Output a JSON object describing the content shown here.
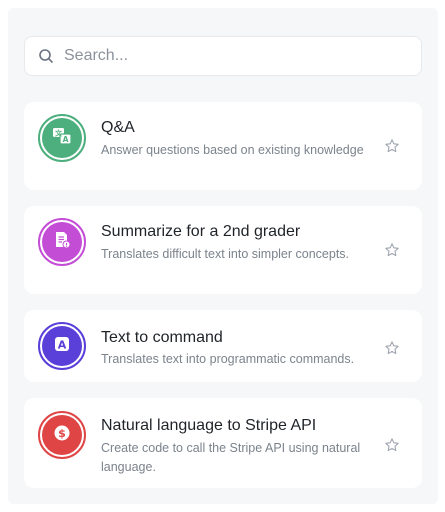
{
  "search": {
    "placeholder": "Search..."
  },
  "items": [
    {
      "title": "Q&A",
      "description": "Answer questions based on existing knowledge",
      "icon": "translate-icon",
      "color": "#4caf7d"
    },
    {
      "title": "Summarize for a 2nd grader",
      "description": "Translates difficult text into simpler concepts.",
      "icon": "document-summary-icon",
      "color": "#c44dd6"
    },
    {
      "title": "Text to command",
      "description": "Translates text into programmatic commands.",
      "icon": "letter-a-icon",
      "color": "#5b3fd9"
    },
    {
      "title": "Natural language to Stripe API",
      "description": "Create code to call the Stripe API using natural language.",
      "icon": "dollar-icon",
      "color": "#e04545"
    }
  ]
}
